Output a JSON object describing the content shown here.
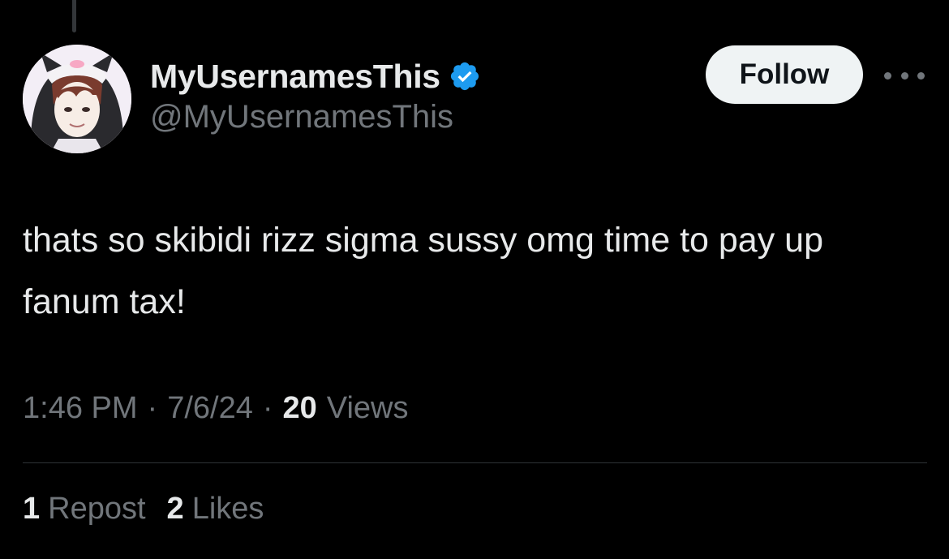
{
  "author": {
    "display_name": "MyUsernamesThis",
    "handle": "@MyUsernamesThis",
    "verified": true,
    "verified_color": "#1d9bf0"
  },
  "actions": {
    "follow_label": "Follow",
    "more_icon": "more-horizontal-icon"
  },
  "tweet": {
    "text": "thats so skibidi rizz sigma sussy omg time to pay up fanum tax!"
  },
  "meta": {
    "time": "1:46 PM",
    "separator": "·",
    "date": "7/6/24",
    "views_count": "20",
    "views_label": "Views"
  },
  "stats": {
    "reposts_count": "1",
    "reposts_label": "Repost",
    "likes_count": "2",
    "likes_label": "Likes"
  },
  "colors": {
    "background": "#000000",
    "primary_text": "#e7e9ea",
    "secondary_text": "#71767b",
    "divider": "#2f3336",
    "follow_button_bg": "#eff3f4"
  }
}
